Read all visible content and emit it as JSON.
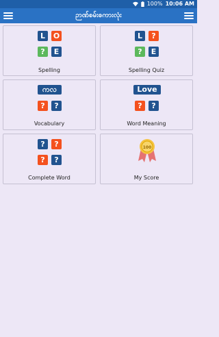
{
  "status_bar": {
    "time": "10:06 AM",
    "battery_percent": "100%"
  },
  "app_bar": {
    "title": "ဉာဏ်စမ်းစကားလုံး"
  },
  "cards": [
    {
      "label": "Spelling",
      "tiles": [
        "L",
        "O",
        "?",
        "E"
      ]
    },
    {
      "label": "Spelling Quiz",
      "tiles": [
        "L",
        "?",
        "?",
        "E"
      ]
    },
    {
      "label": "Vocabulary",
      "banner": "ကလ",
      "tiles": [
        "?",
        "?"
      ]
    },
    {
      "label": "Word Meaning",
      "banner": "Love",
      "tiles": [
        "?",
        "?"
      ]
    },
    {
      "label": "Complete Word",
      "tiles": [
        "?",
        "?",
        "?",
        "?"
      ]
    },
    {
      "label": "My Score",
      "medal_text": "100"
    }
  ]
}
